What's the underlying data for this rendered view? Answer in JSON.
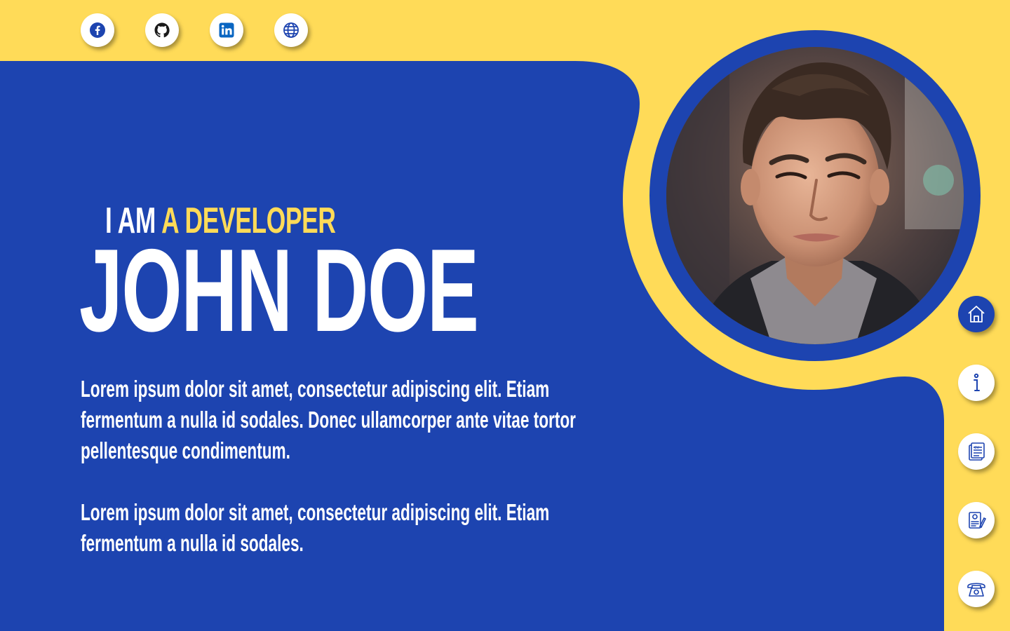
{
  "colors": {
    "primary": "#1d44b0",
    "accent": "#ffdb58",
    "text": "#ffffff"
  },
  "social_links": [
    {
      "name": "facebook",
      "icon": "facebook-icon"
    },
    {
      "name": "github",
      "icon": "github-icon"
    },
    {
      "name": "linkedin",
      "icon": "linkedin-icon"
    },
    {
      "name": "website",
      "icon": "globe-icon"
    }
  ],
  "hero": {
    "tagline_prefix": "I AM",
    "tagline_accent": "A DEVELOPER",
    "name": "JOHN DOE",
    "bio_1": "Lorem ipsum dolor sit amet, consectetur adipiscing elit. Etiam fermentum a nulla id sodales. Donec ullamcorper ante vitae tortor pellentesque condimentum.",
    "bio_2": "Lorem ipsum dolor sit amet, consectetur adipiscing elit. Etiam fermentum a nulla id sodales."
  },
  "profile": {
    "photo_alt": "John Doe"
  },
  "side_nav": [
    {
      "name": "home",
      "icon": "home-icon",
      "active": true
    },
    {
      "name": "about",
      "icon": "info-icon",
      "active": false
    },
    {
      "name": "resume",
      "icon": "cv-icon",
      "active": false
    },
    {
      "name": "certificates",
      "icon": "certificate-icon",
      "active": false
    },
    {
      "name": "contact",
      "icon": "phone-icon",
      "active": false
    }
  ]
}
